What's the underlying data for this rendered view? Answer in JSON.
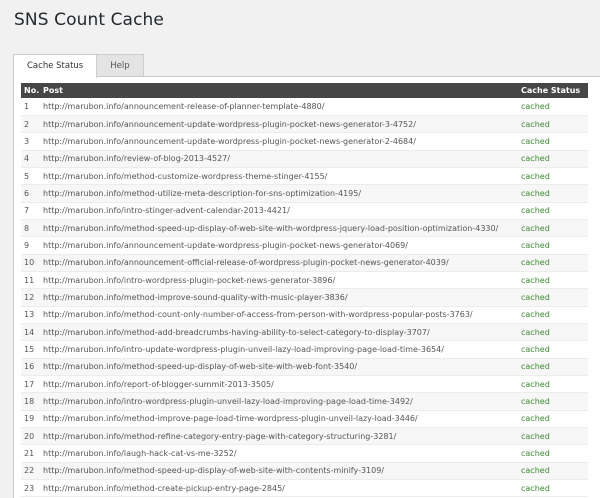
{
  "page": {
    "title": "SNS Count Cache"
  },
  "tabs": [
    {
      "label": "Cache Status",
      "active": true
    },
    {
      "label": "Help",
      "active": false
    }
  ],
  "table": {
    "headers": {
      "no": "No.",
      "post": "Post",
      "status": "Cache Status"
    },
    "rows": [
      {
        "no": "1",
        "post": "http://marubon.info/announcement-release-of-planner-template-4880/",
        "status": "cached"
      },
      {
        "no": "2",
        "post": "http://marubon.info/announcement-update-wordpress-plugin-pocket-news-generator-3-4752/",
        "status": "cached"
      },
      {
        "no": "3",
        "post": "http://marubon.info/announcement-update-wordpress-plugin-pocket-news-generator-2-4684/",
        "status": "cached"
      },
      {
        "no": "4",
        "post": "http://marubon.info/review-of-blog-2013-4527/",
        "status": "cached"
      },
      {
        "no": "5",
        "post": "http://marubon.info/method-customize-wordpress-theme-stinger-4155/",
        "status": "cached"
      },
      {
        "no": "6",
        "post": "http://marubon.info/method-utilize-meta-description-for-sns-optimization-4195/",
        "status": "cached"
      },
      {
        "no": "7",
        "post": "http://marubon.info/intro-stinger-advent-calendar-2013-4421/",
        "status": "cached"
      },
      {
        "no": "8",
        "post": "http://marubon.info/method-speed-up-display-of-web-site-with-wordpress-jquery-load-position-optimization-4330/",
        "status": "cached"
      },
      {
        "no": "9",
        "post": "http://marubon.info/announcement-update-wordpress-plugin-pocket-news-generator-4069/",
        "status": "cached"
      },
      {
        "no": "10",
        "post": "http://marubon.info/announcement-official-release-of-wordpress-plugin-pocket-news-generator-4039/",
        "status": "cached"
      },
      {
        "no": "11",
        "post": "http://marubon.info/intro-wordpress-plugin-pocket-news-generator-3896/",
        "status": "cached"
      },
      {
        "no": "12",
        "post": "http://marubon.info/method-improve-sound-quality-with-music-player-3836/",
        "status": "cached"
      },
      {
        "no": "13",
        "post": "http://marubon.info/method-count-only-number-of-access-from-person-with-wordpress-popular-posts-3763/",
        "status": "cached"
      },
      {
        "no": "14",
        "post": "http://marubon.info/method-add-breadcrumbs-having-ability-to-select-category-to-display-3707/",
        "status": "cached"
      },
      {
        "no": "15",
        "post": "http://marubon.info/intro-update-wordpress-plugin-unveil-lazy-load-improving-page-load-time-3654/",
        "status": "cached"
      },
      {
        "no": "16",
        "post": "http://marubon.info/method-speed-up-display-of-web-site-with-web-font-3540/",
        "status": "cached"
      },
      {
        "no": "17",
        "post": "http://marubon.info/report-of-blogger-summit-2013-3505/",
        "status": "cached"
      },
      {
        "no": "18",
        "post": "http://marubon.info/intro-wordpress-plugin-unveil-lazy-load-improving-page-load-time-3492/",
        "status": "cached"
      },
      {
        "no": "19",
        "post": "http://marubon.info/method-improve-page-load-time-wordpress-plugin-unveil-lazy-load-3446/",
        "status": "cached"
      },
      {
        "no": "20",
        "post": "http://marubon.info/method-refine-category-entry-page-with-category-structuring-3281/",
        "status": "cached"
      },
      {
        "no": "21",
        "post": "http://marubon.info/laugh-hack-cat-vs-me-3252/",
        "status": "cached"
      },
      {
        "no": "22",
        "post": "http://marubon.info/method-speed-up-display-of-web-site-with-contents-minify-3109/",
        "status": "cached"
      },
      {
        "no": "23",
        "post": "http://marubon.info/method-create-pickup-entry-page-2845/",
        "status": "cached"
      }
    ]
  }
}
